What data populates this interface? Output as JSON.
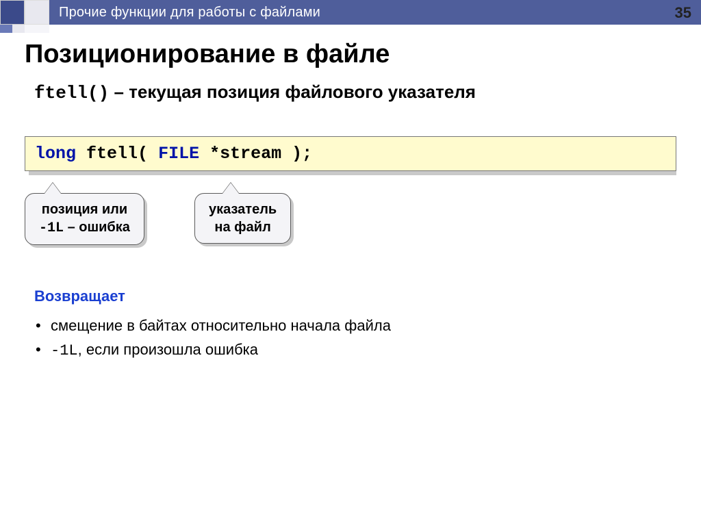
{
  "header": {
    "breadcrumb": "Прочие функции для работы с файлами",
    "page_number": "35"
  },
  "title": "Позиционирование в файле",
  "subtitle": {
    "func": "ftell()",
    "dash": "–",
    "desc": "текущая позиция файлового указателя"
  },
  "signature": {
    "kw1": "long",
    "fn": "ftell(",
    "kw2": "FILE",
    "rest": "*stream );"
  },
  "callouts": {
    "c1_line1": "позиция или",
    "c1_code": "-1L",
    "c1_tail": " – ошибка",
    "c2_line1": "указатель",
    "c2_line2": "на файл"
  },
  "returns": {
    "header": "Возвращает",
    "item1": "смещение в байтах относительно начала файла",
    "item2_code": "-1L",
    "item2_rest": ", если произошла ошибка"
  }
}
